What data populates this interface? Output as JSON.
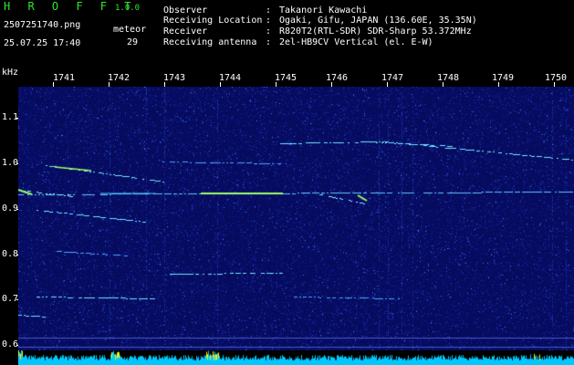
{
  "header": {
    "app_title": "H R O F F T",
    "version": "1.0.0",
    "file_name": "2507251740.png",
    "timestamp": "25.07.25 17:40",
    "meteor_label": "meteor",
    "meteor_count": "29"
  },
  "info": [
    {
      "label": "Observer",
      "value": "Takanori Kawachi"
    },
    {
      "label": "Receiving Location",
      "value": "Ogaki, Gifu, JAPAN (136.60E, 35.35N)"
    },
    {
      "label": "Receiver",
      "value": "R820T2(RTL-SDR) SDR-Sharp 53.372MHz"
    },
    {
      "label": "Receiving antenna",
      "value": "2el-HB9CV Vertical (el. E-W)"
    }
  ],
  "axis": {
    "unit": "kHz",
    "y_ticks": [
      "1.1",
      "1.0",
      "0.9",
      "0.8",
      "0.7",
      "0.6"
    ],
    "x_ticks": [
      "1741",
      "1742",
      "1743",
      "1744",
      "1745",
      "1746",
      "1747",
      "1748",
      "1749",
      "1750"
    ]
  },
  "colors": {
    "background": "#000000",
    "title": "#2ee62e",
    "noise_bg": "#060b5e",
    "trail": "#6fe6ff",
    "strong": "#9dff6a",
    "level_bar": "#00c8ff",
    "level_peak": "#ffee00"
  }
}
